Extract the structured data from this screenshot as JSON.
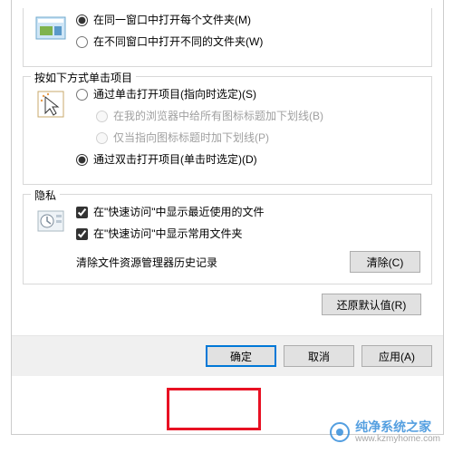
{
  "browse": {
    "open_same": "在同一窗口中打开每个文件夹(M)",
    "open_diff": "在不同窗口中打开不同的文件夹(W)"
  },
  "click": {
    "title": "按如下方式单击项目",
    "single": "通过单击打开项目(指向时选定)(S)",
    "underline_all": "在我的浏览器中给所有图标标题加下划线(B)",
    "underline_hover": "仅当指向图标标题时加下划线(P)",
    "double": "通过双击打开项目(单击时选定)(D)"
  },
  "privacy": {
    "title": "隐私",
    "recent_files": "在\"快速访问\"中显示最近使用的文件",
    "frequent_folders": "在\"快速访问\"中显示常用文件夹",
    "clear_label": "清除文件资源管理器历史记录",
    "clear_btn": "清除(C)"
  },
  "restore_defaults": "还原默认值(R)",
  "footer": {
    "ok": "确定",
    "cancel": "取消",
    "apply": "应用(A)"
  },
  "watermark": {
    "title": "纯净系统之家",
    "url": "www.kzmyhome.com"
  }
}
